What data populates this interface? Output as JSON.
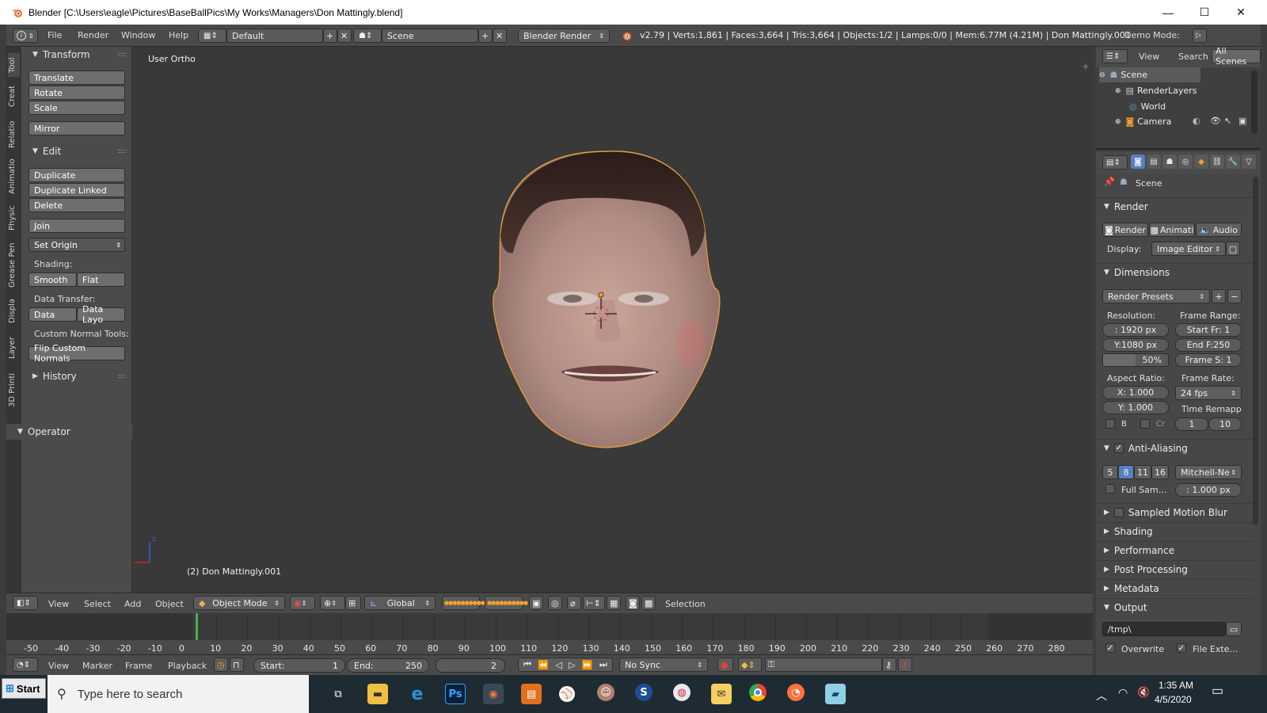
{
  "window": {
    "title": "Blender [C:\\Users\\eagle\\Pictures\\BaseBallPics\\My Works\\Managers\\Don Mattingly.blend]",
    "min_glyph": "—",
    "max_glyph": "☐",
    "close_glyph": "✕"
  },
  "top_header": {
    "menus": [
      "File",
      "Render",
      "Window",
      "Help"
    ],
    "layout": "Default",
    "scene": "Scene",
    "engine": "Blender Render",
    "stats": "v2.79 | Verts:1,861 | Faces:3,664 | Tris:3,664 | Objects:1/2 | Lamps:0/0 | Mem:6.77M (4.21M) | Don Mattingly.001",
    "demo_mode": "Demo Mode:"
  },
  "tool_tabs": [
    "Tool",
    "Creat",
    "Relatio",
    "Animatio",
    "Physic",
    "Grease Pen",
    "Displa",
    "Layer",
    "3D Printi"
  ],
  "tool_shelf": {
    "transform_header": "Transform",
    "translate": "Translate",
    "rotate": "Rotate",
    "scale": "Scale",
    "mirror": "Mirror",
    "edit_header": "Edit",
    "duplicate": "Duplicate",
    "duplicate_linked": "Duplicate Linked",
    "delete": "Delete",
    "join": "Join",
    "set_origin": "Set Origin",
    "shading_label": "Shading:",
    "smooth": "Smooth",
    "flat": "Flat",
    "data_transfer_label": "Data Transfer:",
    "data": "Data",
    "data_layo": "Data Layo",
    "custom_normal_label": "Custom Normal Tools:",
    "flip_custom_normals": "Flip Custom Normals",
    "history_header": "History",
    "operator_header": "Operator"
  },
  "viewport": {
    "view_name": "User Ortho",
    "object_label": "(2) Don Mattingly.001",
    "axis_z": "z"
  },
  "view_header": {
    "menus": [
      "View",
      "Select",
      "Add",
      "Object"
    ],
    "mode": "Object Mode",
    "orientation": "Global",
    "selection": "Selection"
  },
  "timeline": {
    "ticks": [
      "-50",
      "-40",
      "-30",
      "-20",
      "-10",
      "0",
      "10",
      "20",
      "30",
      "40",
      "50",
      "60",
      "70",
      "80",
      "90",
      "100",
      "110",
      "120",
      "130",
      "140",
      "150",
      "160",
      "170",
      "180",
      "190",
      "200",
      "210",
      "220",
      "230",
      "240",
      "250",
      "260",
      "270",
      "280"
    ],
    "menus": [
      "View",
      "Marker",
      "Frame",
      "Playback"
    ],
    "start_label": "Start:",
    "start_value": "1",
    "end_label": "End:",
    "end_value": "250",
    "current_frame": "2",
    "sync": "No Sync"
  },
  "outliner": {
    "menus": [
      "View",
      "Search"
    ],
    "filter": "All Scenes",
    "items": [
      "Scene",
      "RenderLayers",
      "World",
      "Camera"
    ]
  },
  "properties": {
    "context": "Scene",
    "render_header": "Render",
    "render_btn": "Render",
    "anim_btn": "Animati",
    "audio_btn": "Audio",
    "display_label": "Display:",
    "display_value": "Image Editor",
    "dimensions_header": "Dimensions",
    "render_presets": "Render Presets",
    "resolution_label": "Resolution:",
    "res_x": ": 1920 px",
    "res_y": "Y:1080 px",
    "res_pct": "50%",
    "frame_range_label": "Frame Range:",
    "start_fr": "Start Fr: 1",
    "end_fr": "End F:250",
    "frame_step": "Frame S: 1",
    "aspect_label": "Aspect Ratio:",
    "aspect_x": "X:  1.000",
    "aspect_y": "Y:  1.000",
    "frame_rate_label": "Frame Rate:",
    "fps": "24 fps",
    "time_remap": "Time Remapp",
    "border_b": "B",
    "crop_cr": "Cr",
    "remap_old": "1",
    "remap_new": "10",
    "aa_header": "Anti-Aliasing",
    "aa_samples": [
      "5",
      "8",
      "11",
      "16"
    ],
    "aa_filter": "Mitchell-Ne",
    "full_sample": "Full Sam…",
    "filter_size": ": 1.000 px",
    "motion_blur": "Sampled Motion Blur",
    "shading": "Shading",
    "performance": "Performance",
    "post_processing": "Post Processing",
    "metadata": "Metadata",
    "output_header": "Output",
    "output_path": "/tmp\\",
    "overwrite": "Overwrite",
    "file_ext": "File Exte…"
  },
  "taskbar": {
    "start": "Start",
    "search_placeholder": "Type here to search",
    "time": "1:35 AM",
    "date": "4/5/2020"
  },
  "colors": {
    "ui_bg": "#3d3d3d",
    "panel": "#4b4b4b",
    "button": "#6e6e6e",
    "selection_outline": "#f0a030",
    "active_sample": "#5680c2",
    "taskbar": "#1f2b33"
  }
}
